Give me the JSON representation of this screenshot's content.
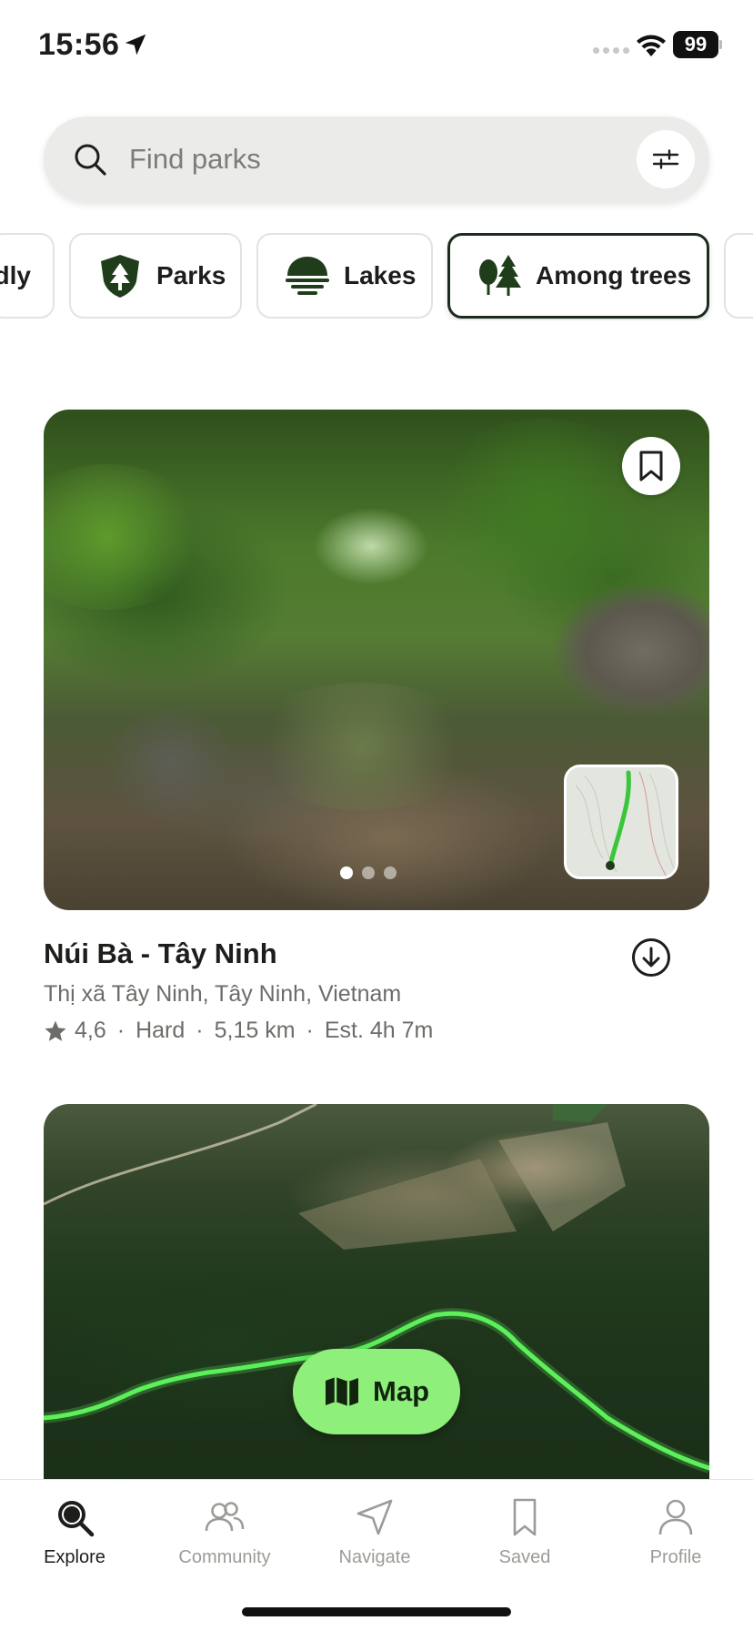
{
  "status_bar": {
    "time": "15:56",
    "battery": "99"
  },
  "search": {
    "placeholder": "Find parks"
  },
  "categories": [
    {
      "label": "dly",
      "icon": "partial-chip"
    },
    {
      "label": "Parks",
      "icon": "park-shield-icon"
    },
    {
      "label": "Lakes",
      "icon": "lake-icon"
    },
    {
      "label": "Among trees",
      "icon": "trees-icon",
      "active": true
    }
  ],
  "trails": [
    {
      "name": "Núi Bà - Tây Ninh",
      "location": "Thị xã Tây Ninh, Tây Ninh, Vietnam",
      "rating": "4,6",
      "difficulty": "Hard",
      "distance": "5,15 km",
      "estimate": "Est. 4h 7m",
      "photo_count": 3,
      "current_photo": 1
    }
  ],
  "map_button": {
    "label": "Map"
  },
  "nav": {
    "explore": "Explore",
    "community": "Community",
    "navigate": "Navigate",
    "saved": "Saved",
    "profile": "Profile",
    "active": "explore"
  },
  "colors": {
    "accent": "#8ef07a",
    "route": "#5df05a",
    "brand_dark": "#1d2a1d",
    "muted_text": "#6c6c68"
  }
}
